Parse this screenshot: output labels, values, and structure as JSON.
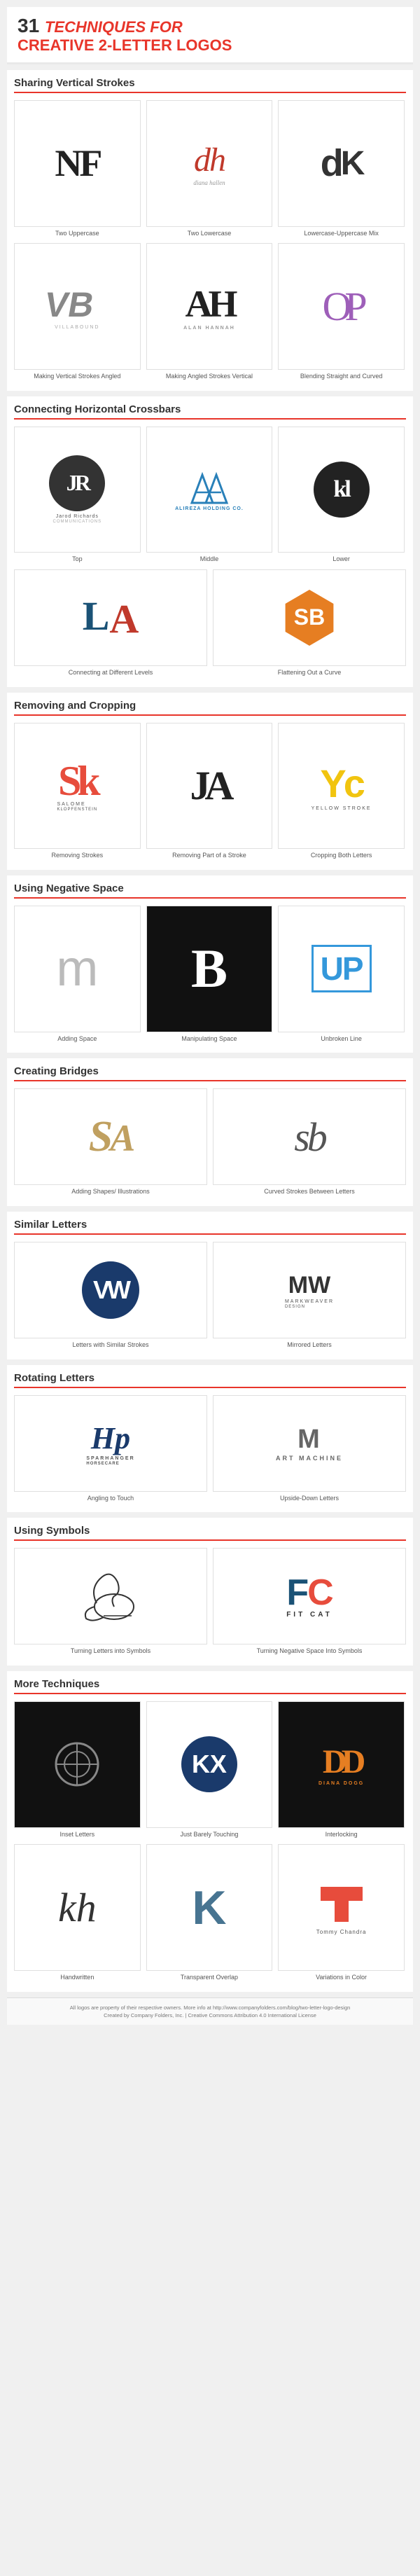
{
  "header": {
    "number": "31",
    "line1": "TECHNIQUES FOR",
    "line2": "CREATIVE 2-LETTER LOGOS"
  },
  "sections": [
    {
      "id": "sharing-vertical-strokes",
      "title": "Sharing Vertical Strokes",
      "items": [
        {
          "id": "nf",
          "label": "Two Uppercase"
        },
        {
          "id": "dh",
          "label": "Two Lowercase"
        },
        {
          "id": "dk",
          "label": "Lowercase-Uppercase Mix"
        },
        {
          "id": "vb",
          "label": "Making Vertical Strokes Angled"
        },
        {
          "id": "ah",
          "label": "Making Angled Strokes Vertical"
        },
        {
          "id": "op",
          "label": "Blending Straight and Curved"
        }
      ]
    },
    {
      "id": "connecting-horizontal",
      "title": "Connecting Horizontal Crossbars",
      "items": [
        {
          "id": "jr",
          "label": "Top"
        },
        {
          "id": "alireza",
          "label": "Middle"
        },
        {
          "id": "kl",
          "label": "Lower"
        },
        {
          "id": "la",
          "label": "Connecting at Different Levels"
        },
        {
          "id": "sb",
          "label": "Flattening Out a Curve"
        }
      ]
    },
    {
      "id": "removing-cropping",
      "title": "Removing and Cropping",
      "items": [
        {
          "id": "sk",
          "label": "Removing Strokes"
        },
        {
          "id": "ja",
          "label": "Removing Part of a Stroke"
        },
        {
          "id": "yc",
          "label": "Cropping Both Letters"
        }
      ]
    },
    {
      "id": "negative-space",
      "title": "Using Negative Space",
      "items": [
        {
          "id": "m",
          "label": "Adding Space"
        },
        {
          "id": "b",
          "label": "Manipulating Space"
        },
        {
          "id": "up",
          "label": "Unbroken Line"
        }
      ]
    },
    {
      "id": "bridges",
      "title": "Creating Bridges",
      "items": [
        {
          "id": "sa",
          "label": "Adding Shapes/ Illustrations"
        },
        {
          "id": "sb2",
          "label": "Curved Strokes Between Letters"
        }
      ]
    },
    {
      "id": "similar-letters",
      "title": "Similar Letters",
      "items": [
        {
          "id": "vw",
          "label": "Letters with Similar Strokes"
        },
        {
          "id": "mw",
          "label": "Mirrored Letters"
        }
      ]
    },
    {
      "id": "rotating",
      "title": "Rotating Letters",
      "items": [
        {
          "id": "sp",
          "label": "Angling to Touch"
        },
        {
          "id": "artm",
          "label": "Upside-Down Letters"
        }
      ]
    },
    {
      "id": "symbols",
      "title": "Using Symbols",
      "items": [
        {
          "id": "swan",
          "label": "Turning Letters into Symbols"
        },
        {
          "id": "fc",
          "label": "Turning Negative Space Into Symbols"
        }
      ]
    },
    {
      "id": "more",
      "title": "More Techniques",
      "items": [
        {
          "id": "comedy",
          "label": "Inset Letters"
        },
        {
          "id": "kx",
          "label": "Just Barely Touching"
        },
        {
          "id": "dd",
          "label": "Interlocking"
        },
        {
          "id": "kh",
          "label": "Handwritten"
        },
        {
          "id": "kt",
          "label": "Transparent Overlap"
        },
        {
          "id": "tc",
          "label": "Variations in Color"
        }
      ]
    }
  ],
  "footer": {
    "line1": "All logos are property of their respective owners. More info at http://www.companyfolders.com/blog/two-letter-logo-design",
    "line2": "Created by Company Folders, Inc. | Creative Commons Attribution 4.0 International License"
  }
}
